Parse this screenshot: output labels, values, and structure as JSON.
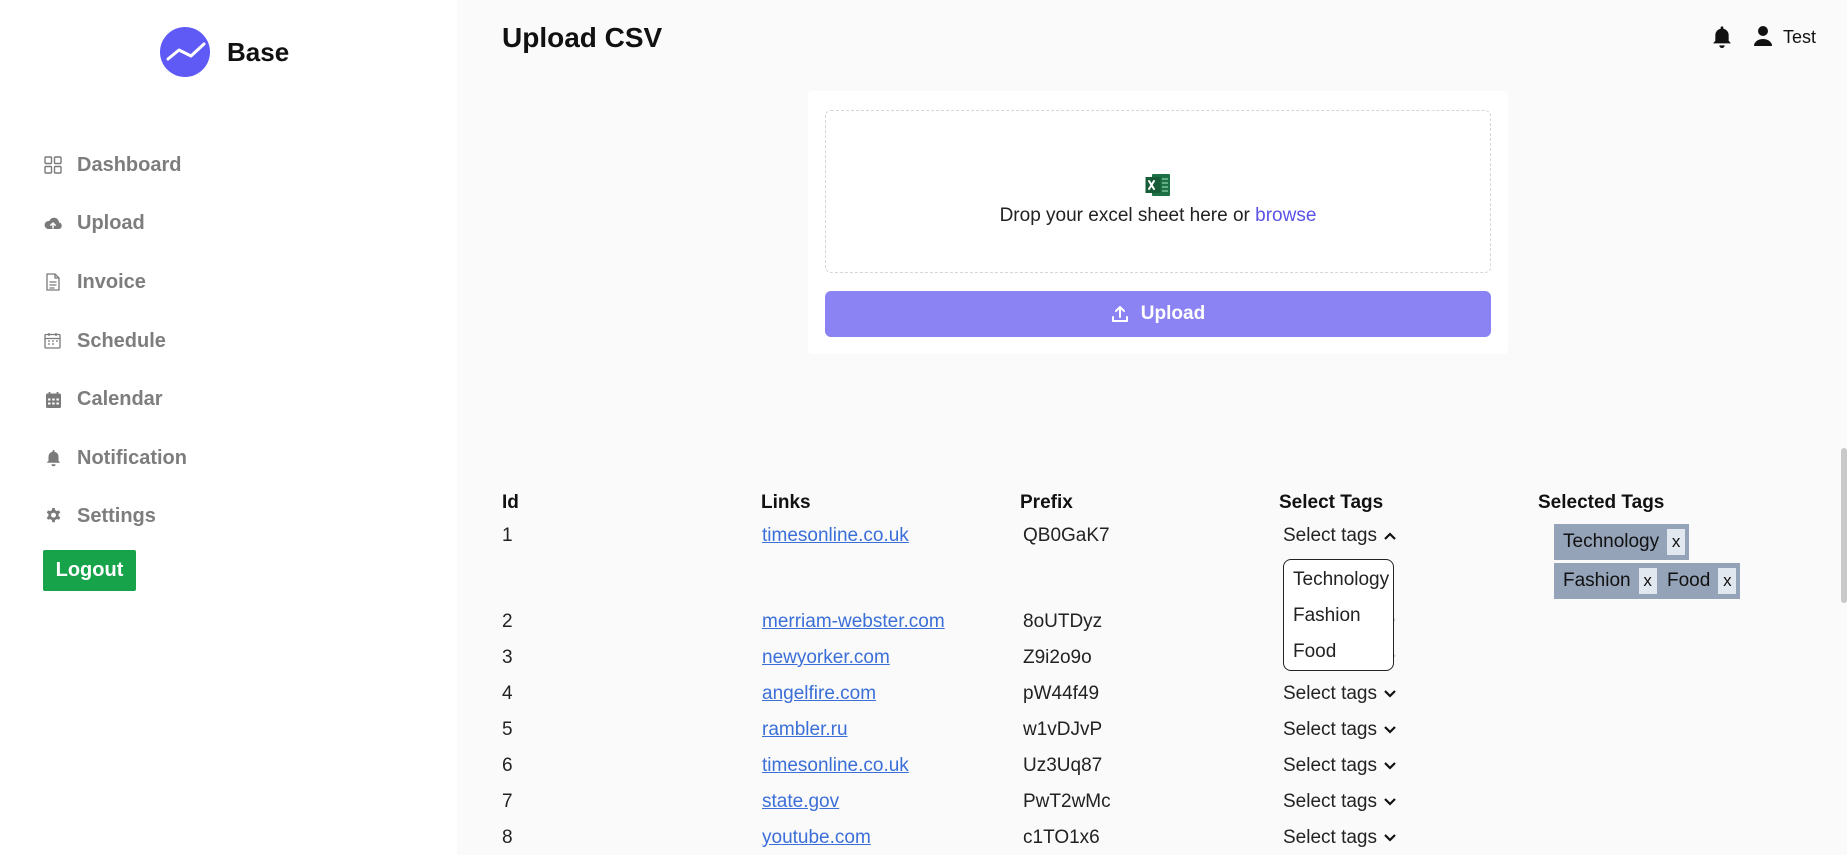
{
  "brand": {
    "name": "Base",
    "accent": "#5f5af6"
  },
  "nav": [
    {
      "label": "Dashboard",
      "icon": "dashboard-icon"
    },
    {
      "label": "Upload",
      "icon": "cloud-upload-icon"
    },
    {
      "label": "Invoice",
      "icon": "invoice-icon"
    },
    {
      "label": "Schedule",
      "icon": "schedule-icon"
    },
    {
      "label": "Calendar",
      "icon": "calendar-icon"
    },
    {
      "label": "Notification",
      "icon": "bell-icon"
    },
    {
      "label": "Settings",
      "icon": "gear-icon"
    }
  ],
  "logout_label": "Logout",
  "header": {
    "title": "Upload CSV",
    "user": "Test"
  },
  "upload": {
    "drop_text": "Drop your excel sheet here or ",
    "browse_label": "browse",
    "button_label": "Upload"
  },
  "table": {
    "headers": [
      "Id",
      "Links",
      "Prefix",
      "Select Tags",
      "Selected Tags"
    ],
    "select_label": "Select tags",
    "rows": [
      {
        "id": "1",
        "link": "timesonline.co.uk",
        "prefix": "QB0GaK7"
      },
      {
        "id": "2",
        "link": "merriam-webster.com",
        "prefix": "8oUTDyz"
      },
      {
        "id": "3",
        "link": "newyorker.com",
        "prefix": "Z9i2o9o"
      },
      {
        "id": "4",
        "link": "angelfire.com",
        "prefix": "pW44f49"
      },
      {
        "id": "5",
        "link": "rambler.ru",
        "prefix": "w1vDJvP"
      },
      {
        "id": "6",
        "link": "timesonline.co.uk",
        "prefix": "Uz3Uq87"
      },
      {
        "id": "7",
        "link": "state.gov",
        "prefix": "PwT2wMc"
      },
      {
        "id": "8",
        "link": "youtube.com",
        "prefix": "c1TO1x6"
      }
    ]
  },
  "dropdown_options": [
    "Technology",
    "Fashion",
    "Food"
  ],
  "selected_tags": [
    "Technology",
    "Fashion",
    "Food"
  ],
  "tag_remove_label": "x",
  "colors": {
    "logout": "#16a34a",
    "upload_button": "#8b83f3",
    "tag": "#94a3b8",
    "link": "#3b6fd8"
  }
}
